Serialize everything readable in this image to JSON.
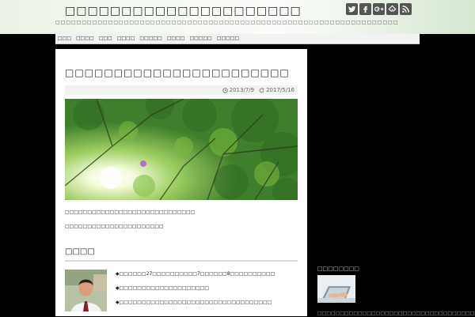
{
  "colors": {
    "header_bg": "#f2f7ef",
    "body_bg": "#000000",
    "content_bg": "#ffffff",
    "icon": "#555555"
  },
  "header": {
    "title": "□□□□□□□□□□□□□□□□□□□□□",
    "description": "□□□□□□□□□□□□□□□□□□□□□□□□□□□□□□□□□□□□□□□□□□□□□□□□□□□□□□□□□□□□□□□□□",
    "social_icons": [
      "twitter-icon",
      "facebook-icon",
      "google-plus-icon",
      "feedly-icon",
      "rss-icon"
    ]
  },
  "nav": {
    "items": [
      "□□□",
      "□□□□",
      "□□□",
      "□□□□",
      "□□□□□",
      "□□□□",
      "□□□□□",
      "□□□□□"
    ]
  },
  "post": {
    "title": "□□□□□□□□□□□□□□□□□□□□□□□",
    "published": "2013/7/9",
    "updated": "2017/5/16",
    "paragraph1": "□□□□□□□□□□□□□□□□□□□□□□□□□□□□□",
    "paragraph2": "□□□□□□□□□□□□□□□□□□□□□□",
    "section_heading": "□□□□",
    "bullets": [
      "◆□□□□□□27□□□□□□□□□□7□□□□□□8□□□□□□□□□□",
      "◆□□□□□□□□□□□□□□□□□□□□",
      "◆□□□□□□□□□□□□□□□□□□□□□□□□□□□□□□□□□□"
    ]
  },
  "sidebar": {
    "heading": "□□□□□□□□",
    "link": "□□□□□□□□□□□□□□□□□□□□□□□□□□□□□□□□□□□□□□□"
  }
}
